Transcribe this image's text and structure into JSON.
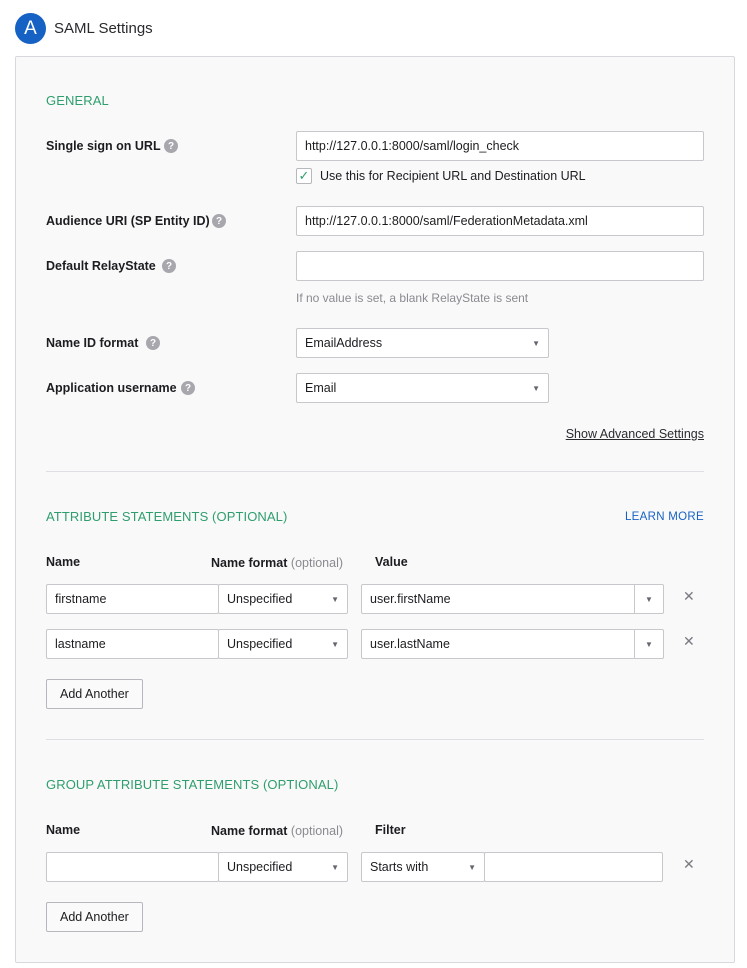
{
  "header": {
    "step_badge": "A",
    "title": "SAML Settings"
  },
  "general": {
    "section_title": "GENERAL",
    "sso_url": {
      "label": "Single sign on URL",
      "value": "http://127.0.0.1:8000/saml/login_check"
    },
    "recipient_checkbox": {
      "label": "Use this for Recipient URL and Destination URL",
      "checked": true
    },
    "audience_uri": {
      "label": "Audience URI (SP Entity ID)",
      "value": "http://127.0.0.1:8000/saml/FederationMetadata.xml"
    },
    "relay_state": {
      "label": "Default RelayState",
      "value": "",
      "hint": "If no value is set, a blank RelayState is sent"
    },
    "name_id_format": {
      "label": "Name ID format",
      "value": "EmailAddress"
    },
    "app_username": {
      "label": "Application username",
      "value": "Email"
    },
    "advanced_link": "Show Advanced Settings"
  },
  "attributes": {
    "section_title": "ATTRIBUTE STATEMENTS (OPTIONAL)",
    "learn_more": "LEARN MORE",
    "col_name": "Name",
    "col_format": "Name format",
    "col_format_optional": "(optional)",
    "col_value": "Value",
    "rows": [
      {
        "name": "firstname",
        "format": "Unspecified",
        "value": "user.firstName"
      },
      {
        "name": "lastname",
        "format": "Unspecified",
        "value": "user.lastName"
      }
    ],
    "add_button": "Add Another"
  },
  "group_attributes": {
    "section_title": "GROUP ATTRIBUTE STATEMENTS (OPTIONAL)",
    "col_name": "Name",
    "col_format": "Name format",
    "col_format_optional": "(optional)",
    "col_filter": "Filter",
    "rows": [
      {
        "name": "",
        "format": "Unspecified",
        "filter_type": "Starts with",
        "filter_value": ""
      }
    ],
    "add_button": "Add Another"
  },
  "icons": {
    "help": "help-icon",
    "dropdown": "caret-down-icon",
    "remove": "close-icon",
    "check": "checkmark-icon"
  },
  "colors": {
    "accent_green": "#2f9e6e",
    "brand_blue": "#1662c4"
  }
}
